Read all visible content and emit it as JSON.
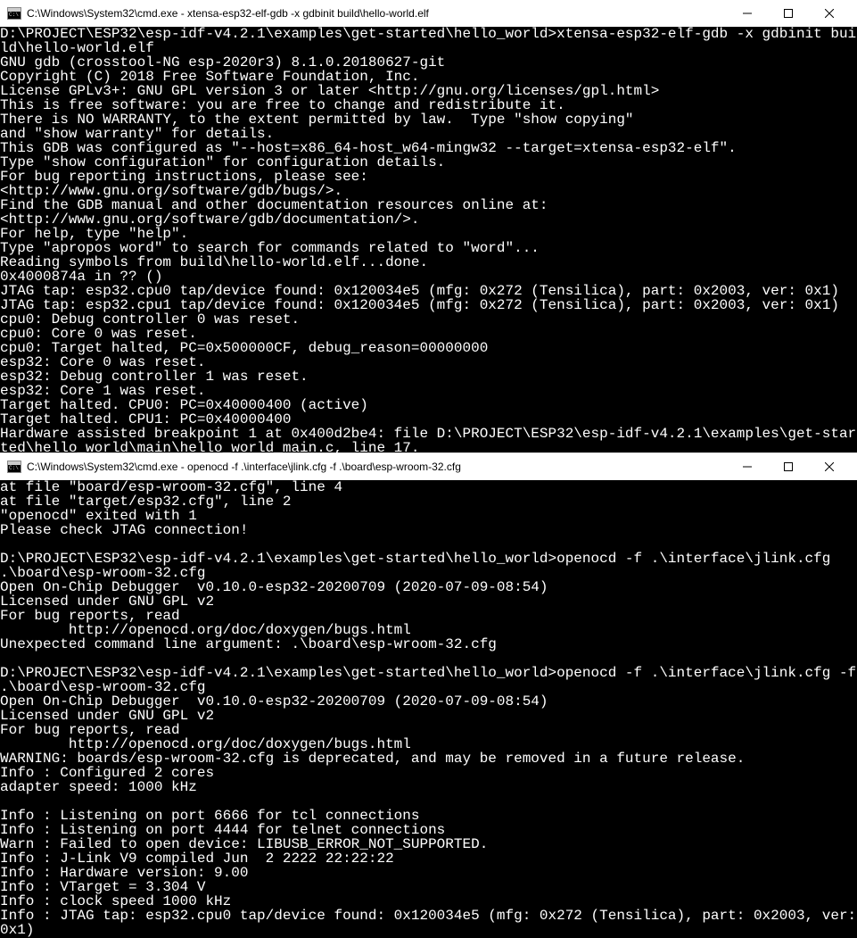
{
  "window1": {
    "title": "C:\\Windows\\System32\\cmd.exe - xtensa-esp32-elf-gdb  -x gdbinit build\\hello-world.elf",
    "content": "D:\\PROJECT\\ESP32\\esp-idf-v4.2.1\\examples\\get-started\\hello_world>xtensa-esp32-elf-gdb -x gdbinit build\\hello-world.elf\nGNU gdb (crosstool-NG esp-2020r3) 8.1.0.20180627-git\nCopyright (C) 2018 Free Software Foundation, Inc.\nLicense GPLv3+: GNU GPL version 3 or later <http://gnu.org/licenses/gpl.html>\nThis is free software: you are free to change and redistribute it.\nThere is NO WARRANTY, to the extent permitted by law.  Type \"show copying\"\nand \"show warranty\" for details.\nThis GDB was configured as \"--host=x86_64-host_w64-mingw32 --target=xtensa-esp32-elf\".\nType \"show configuration\" for configuration details.\nFor bug reporting instructions, please see:\n<http://www.gnu.org/software/gdb/bugs/>.\nFind the GDB manual and other documentation resources online at:\n<http://www.gnu.org/software/gdb/documentation/>.\nFor help, type \"help\".\nType \"apropos word\" to search for commands related to \"word\"...\nReading symbols from build\\hello-world.elf...done.\n0x4000874a in ?? ()\nJTAG tap: esp32.cpu0 tap/device found: 0x120034e5 (mfg: 0x272 (Tensilica), part: 0x2003, ver: 0x1)\nJTAG tap: esp32.cpu1 tap/device found: 0x120034e5 (mfg: 0x272 (Tensilica), part: 0x2003, ver: 0x1)\ncpu0: Debug controller 0 was reset.\ncpu0: Core 0 was reset.\ncpu0: Target halted, PC=0x500000CF, debug_reason=00000000\nesp32: Core 0 was reset.\nesp32: Debug controller 1 was reset.\nesp32: Core 1 was reset.\nTarget halted. CPU0: PC=0x40000400 (active)\nTarget halted. CPU1: PC=0x40000400\nHardware assisted breakpoint 1 at 0x400d2be4: file D:\\PROJECT\\ESP32\\esp-idf-v4.2.1\\examples\\get-started\\hello_world\\main\\hello_world_main.c, line 17."
  },
  "window2": {
    "title": "C:\\Windows\\System32\\cmd.exe - openocd  -f .\\interface\\jlink.cfg -f .\\board\\esp-wroom-32.cfg",
    "content": "at file \"board/esp-wroom-32.cfg\", line 4\nat file \"target/esp32.cfg\", line 2\n\"openocd\" exited with 1\nPlease check JTAG connection!\n\nD:\\PROJECT\\ESP32\\esp-idf-v4.2.1\\examples\\get-started\\hello_world>openocd -f .\\interface\\jlink.cfg .\\board\\esp-wroom-32.cfg\nOpen On-Chip Debugger  v0.10.0-esp32-20200709 (2020-07-09-08:54)\nLicensed under GNU GPL v2\nFor bug reports, read\n        http://openocd.org/doc/doxygen/bugs.html\nUnexpected command line argument: .\\board\\esp-wroom-32.cfg\n\nD:\\PROJECT\\ESP32\\esp-idf-v4.2.1\\examples\\get-started\\hello_world>openocd -f .\\interface\\jlink.cfg -f .\\board\\esp-wroom-32.cfg\nOpen On-Chip Debugger  v0.10.0-esp32-20200709 (2020-07-09-08:54)\nLicensed under GNU GPL v2\nFor bug reports, read\n        http://openocd.org/doc/doxygen/bugs.html\nWARNING: boards/esp-wroom-32.cfg is deprecated, and may be removed in a future release.\nInfo : Configured 2 cores\nadapter speed: 1000 kHz\n\nInfo : Listening on port 6666 for tcl connections\nInfo : Listening on port 4444 for telnet connections\nWarn : Failed to open device: LIBUSB_ERROR_NOT_SUPPORTED.\nInfo : J-Link V9 compiled Jun  2 2222 22:22:22\nInfo : Hardware version: 9.00\nInfo : VTarget = 3.304 V\nInfo : clock speed 1000 kHz\nInfo : JTAG tap: esp32.cpu0 tap/device found: 0x120034e5 (mfg: 0x272 (Tensilica), part: 0x2003, ver: 0x1)"
  }
}
